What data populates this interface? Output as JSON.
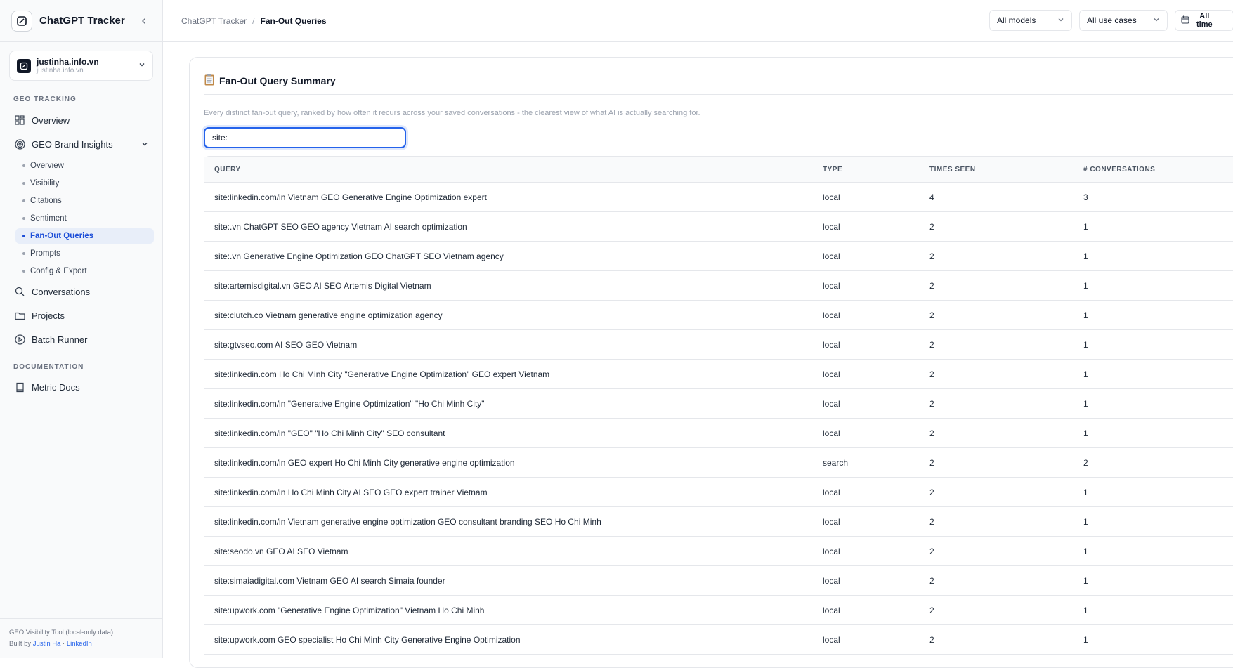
{
  "app": {
    "title": "ChatGPT Tracker"
  },
  "workspace": {
    "name": "justinha.info.vn",
    "domain": "justinha.info.vn"
  },
  "sidebar": {
    "geo_label": "GEO TRACKING",
    "overview": "Overview",
    "brand_insights": "GEO Brand Insights",
    "sub_items": [
      "Overview",
      "Visibility",
      "Citations",
      "Sentiment",
      "Fan-Out Queries",
      "Prompts",
      "Config & Export"
    ],
    "conversations": "Conversations",
    "projects": "Projects",
    "batch_runner": "Batch Runner",
    "doc_label": "DOCUMENTATION",
    "metric_docs": "Metric Docs"
  },
  "footer": {
    "line1": "GEO Visibility Tool (local-only data)",
    "built_by": "Built by",
    "author": "Justin Ha",
    "sep": "·",
    "linkedin": "LinkedIn"
  },
  "breadcrumb": {
    "root": "ChatGPT Tracker",
    "sep": "/",
    "current": "Fan-Out Queries"
  },
  "filters": {
    "models": "All models",
    "use_cases": "All use cases",
    "time_line1": "All",
    "time_line2": "time"
  },
  "card": {
    "title": "Fan-Out Query Summary",
    "description": "Every distinct fan-out query, ranked by how often it recurs across your saved conversations - the clearest view of what AI is actually searching for.",
    "search_value": "site:"
  },
  "table": {
    "headers": {
      "query": "QUERY",
      "type": "TYPE",
      "times_seen": "TIMES SEEN",
      "conversations": "# CONVERSATIONS"
    },
    "rows": [
      {
        "query": "site:linkedin.com/in Vietnam GEO Generative Engine Optimization expert",
        "type": "local",
        "seen": "4",
        "convs": "3"
      },
      {
        "query": "site:.vn ChatGPT SEO GEO agency Vietnam AI search optimization",
        "type": "local",
        "seen": "2",
        "convs": "1"
      },
      {
        "query": "site:.vn Generative Engine Optimization GEO ChatGPT SEO Vietnam agency",
        "type": "local",
        "seen": "2",
        "convs": "1"
      },
      {
        "query": "site:artemisdigital.vn GEO AI SEO Artemis Digital Vietnam",
        "type": "local",
        "seen": "2",
        "convs": "1"
      },
      {
        "query": "site:clutch.co Vietnam generative engine optimization agency",
        "type": "local",
        "seen": "2",
        "convs": "1"
      },
      {
        "query": "site:gtvseo.com AI SEO GEO Vietnam",
        "type": "local",
        "seen": "2",
        "convs": "1"
      },
      {
        "query": "site:linkedin.com Ho Chi Minh City \"Generative Engine Optimization\" GEO expert Vietnam",
        "type": "local",
        "seen": "2",
        "convs": "1"
      },
      {
        "query": "site:linkedin.com/in \"Generative Engine Optimization\" \"Ho Chi Minh City\"",
        "type": "local",
        "seen": "2",
        "convs": "1"
      },
      {
        "query": "site:linkedin.com/in \"GEO\" \"Ho Chi Minh City\" SEO consultant",
        "type": "local",
        "seen": "2",
        "convs": "1"
      },
      {
        "query": "site:linkedin.com/in GEO expert Ho Chi Minh City generative engine optimization",
        "type": "search",
        "seen": "2",
        "convs": "2"
      },
      {
        "query": "site:linkedin.com/in Ho Chi Minh City AI SEO GEO expert trainer Vietnam",
        "type": "local",
        "seen": "2",
        "convs": "1"
      },
      {
        "query": "site:linkedin.com/in Vietnam generative engine optimization GEO consultant branding SEO Ho Chi Minh",
        "type": "local",
        "seen": "2",
        "convs": "1"
      },
      {
        "query": "site:seodo.vn GEO AI SEO Vietnam",
        "type": "local",
        "seen": "2",
        "convs": "1"
      },
      {
        "query": "site:simaiadigital.com Vietnam GEO AI search Simaia founder",
        "type": "local",
        "seen": "2",
        "convs": "1"
      },
      {
        "query": "site:upwork.com \"Generative Engine Optimization\" Vietnam Ho Chi Minh",
        "type": "local",
        "seen": "2",
        "convs": "1"
      },
      {
        "query": "site:upwork.com GEO specialist Ho Chi Minh City Generative Engine Optimization",
        "type": "local",
        "seen": "2",
        "convs": "1"
      }
    ]
  }
}
